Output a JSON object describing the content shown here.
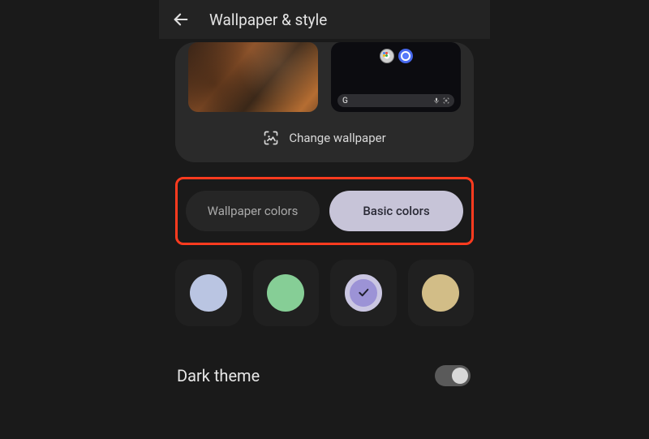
{
  "header": {
    "title": "Wallpaper & style"
  },
  "preview": {
    "change_label": "Change wallpaper"
  },
  "tabs": {
    "wallpaper_colors": "Wallpaper colors",
    "basic_colors": "Basic colors",
    "active": "basic"
  },
  "swatches": [
    {
      "name": "lavender-blue",
      "color": "#bac5e2",
      "selected": false
    },
    {
      "name": "mint-green",
      "color": "#86ce96",
      "selected": false
    },
    {
      "name": "periwinkle",
      "color": "#9c93d6",
      "selected": true
    },
    {
      "name": "sand-beige",
      "color": "#d2bd87",
      "selected": false
    }
  ],
  "dark_theme": {
    "label": "Dark theme",
    "enabled": true
  }
}
